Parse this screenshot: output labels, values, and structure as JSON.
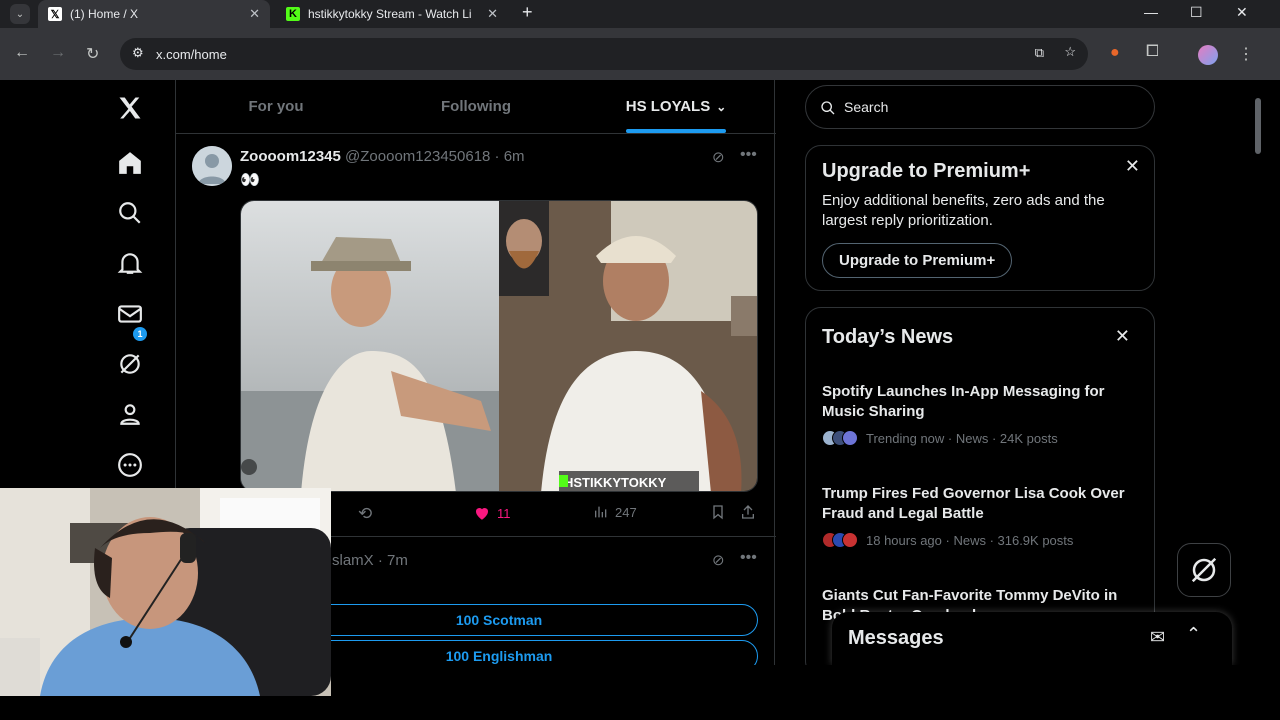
{
  "browser": {
    "tabs": [
      {
        "title": "(1) Home / X",
        "active": true
      },
      {
        "title": "hstikkytokky Stream - Watch Li",
        "active": false
      }
    ],
    "url": "x.com/home",
    "new_tab_symbol": "+"
  },
  "feed": {
    "tabs": [
      "For you",
      "Following",
      "HS LOYALS"
    ],
    "selected_tab": "HS LOYALS",
    "post1": {
      "name": "Zoooom12345",
      "handle_time": "@Zoooom123450618 · 6m",
      "text": "👀",
      "media_watermark": "HSTIKKYTOKKY",
      "likes": "11",
      "views": "247"
    },
    "post2": {
      "handle_time": "slamX · 7m",
      "poll_options": [
        "100 Scotman",
        "100 Englishman"
      ]
    }
  },
  "sidebar_right": {
    "search_placeholder": "Search",
    "premium": {
      "title": "Upgrade to Premium+",
      "body": "Enjoy additional benefits, zero ads and the largest reply prioritization.",
      "button": "Upgrade to Premium+"
    },
    "news": {
      "title": "Today’s News",
      "items": [
        {
          "headline": "Spotify Launches In-App Messaging for Music Sharing",
          "meta": "Trending now · News · 24K posts"
        },
        {
          "headline": "Trump Fires Fed Governor Lisa Cook Over Fraud and Legal Battle",
          "meta": "18 hours ago · News · 316.9K posts"
        },
        {
          "headline": "Giants Cut Fan-Favorite Tommy DeVito in Bold Roster Overhaul",
          "meta": ""
        }
      ]
    }
  },
  "messages": {
    "title": "Messages"
  },
  "notifications_badge": "1",
  "colors": {
    "accent": "#1d9bf0",
    "like": "#f91880",
    "bg": "#000000",
    "border": "#2f3336"
  },
  "icons": [
    "x-logo-icon",
    "home-icon",
    "search-icon",
    "bell-icon",
    "mail-icon",
    "grok-icon",
    "profile-icon",
    "more-icon"
  ]
}
